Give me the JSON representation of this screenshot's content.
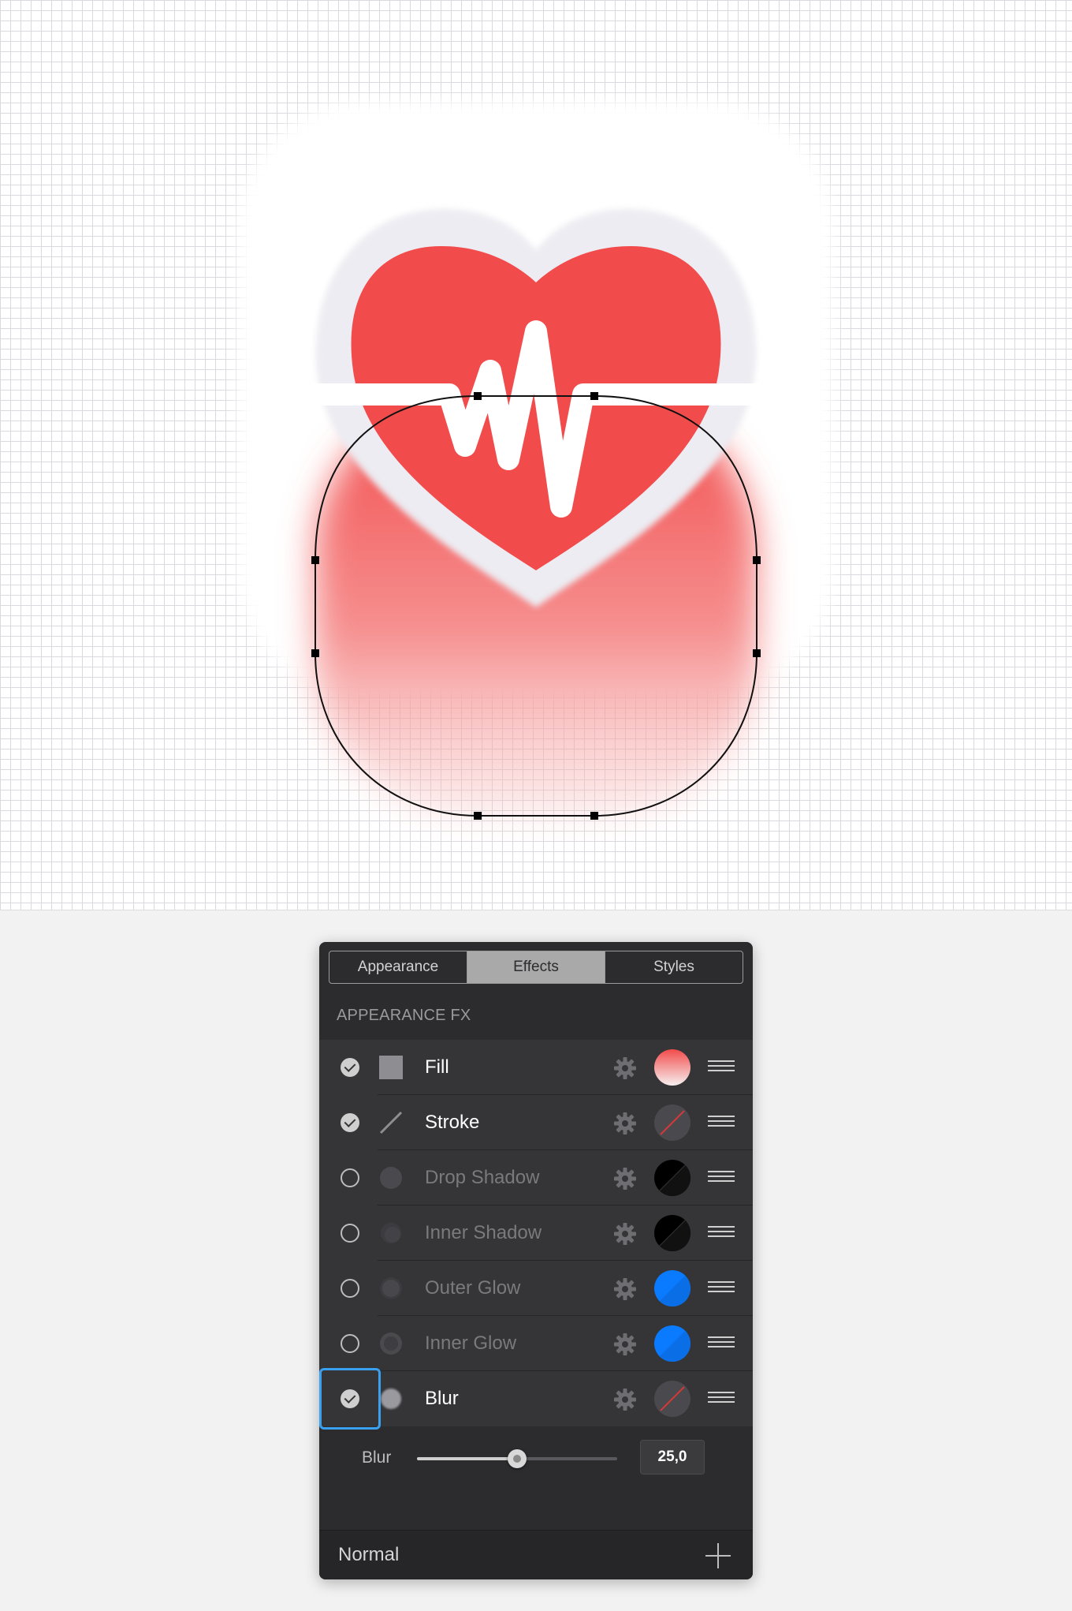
{
  "tabs": [
    {
      "label": "Appearance",
      "active": false
    },
    {
      "label": "Effects",
      "active": true
    },
    {
      "label": "Styles",
      "active": false
    }
  ],
  "section_header": "APPEARANCE FX",
  "effects": [
    {
      "label": "Fill",
      "enabled": true,
      "icon": "fill-square-icon",
      "swatch": "gradient-red"
    },
    {
      "label": "Stroke",
      "enabled": true,
      "icon": "stroke-line-icon",
      "swatch": "none"
    },
    {
      "label": "Drop Shadow",
      "enabled": false,
      "icon": "drop-shadow-icon",
      "swatch": "black"
    },
    {
      "label": "Inner Shadow",
      "enabled": false,
      "icon": "inner-shadow-icon",
      "swatch": "black"
    },
    {
      "label": "Outer Glow",
      "enabled": false,
      "icon": "outer-glow-icon",
      "swatch": "blue"
    },
    {
      "label": "Inner Glow",
      "enabled": false,
      "icon": "inner-glow-icon",
      "swatch": "blue"
    },
    {
      "label": "Blur",
      "enabled": true,
      "icon": "blur-icon",
      "swatch": "none",
      "focused": true
    }
  ],
  "blur_control": {
    "label": "Blur",
    "value": "25,0",
    "slider_fraction": 0.5
  },
  "blend_mode": "Normal",
  "colors": {
    "heart_red": "#f24b4b",
    "accent_blue": "#0a7bff",
    "focus_blue": "#3aa0f0",
    "panel_bg": "#2c2c2e"
  }
}
